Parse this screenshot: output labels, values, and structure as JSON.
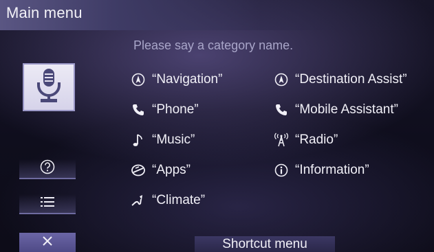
{
  "header": {
    "title": "Main menu"
  },
  "prompt": "Please say a category name.",
  "side_buttons": [
    {
      "name": "help",
      "icon": "help-circle-icon"
    },
    {
      "name": "list",
      "icon": "list-icon"
    },
    {
      "name": "close",
      "icon": "close-icon"
    }
  ],
  "mic_button": {
    "icon": "microphone-icon"
  },
  "commands": {
    "left": [
      {
        "label": "“Navigation”",
        "icon": "navigation-compass-icon"
      },
      {
        "label": "“Phone”",
        "icon": "phone-icon"
      },
      {
        "label": "“Music”",
        "icon": "music-note-icon"
      },
      {
        "label": "“Apps”",
        "icon": "apps-icon"
      },
      {
        "label": "“Climate”",
        "icon": "climate-fan-icon"
      }
    ],
    "right": [
      {
        "label": "“Destination Assist”",
        "icon": "navigation-compass-icon"
      },
      {
        "label": "“Mobile Assistant”",
        "icon": "phone-icon"
      },
      {
        "label": "“Radio”",
        "icon": "radio-tower-icon"
      },
      {
        "label": "“Information”",
        "icon": "info-icon"
      }
    ]
  },
  "footer": {
    "shortcut_label": "Shortcut menu"
  },
  "colors": {
    "accent": "#5a5683",
    "mic_bg": "#e6e4f2",
    "text": "#f1f0f7",
    "prompt": "#a9a6c9"
  }
}
